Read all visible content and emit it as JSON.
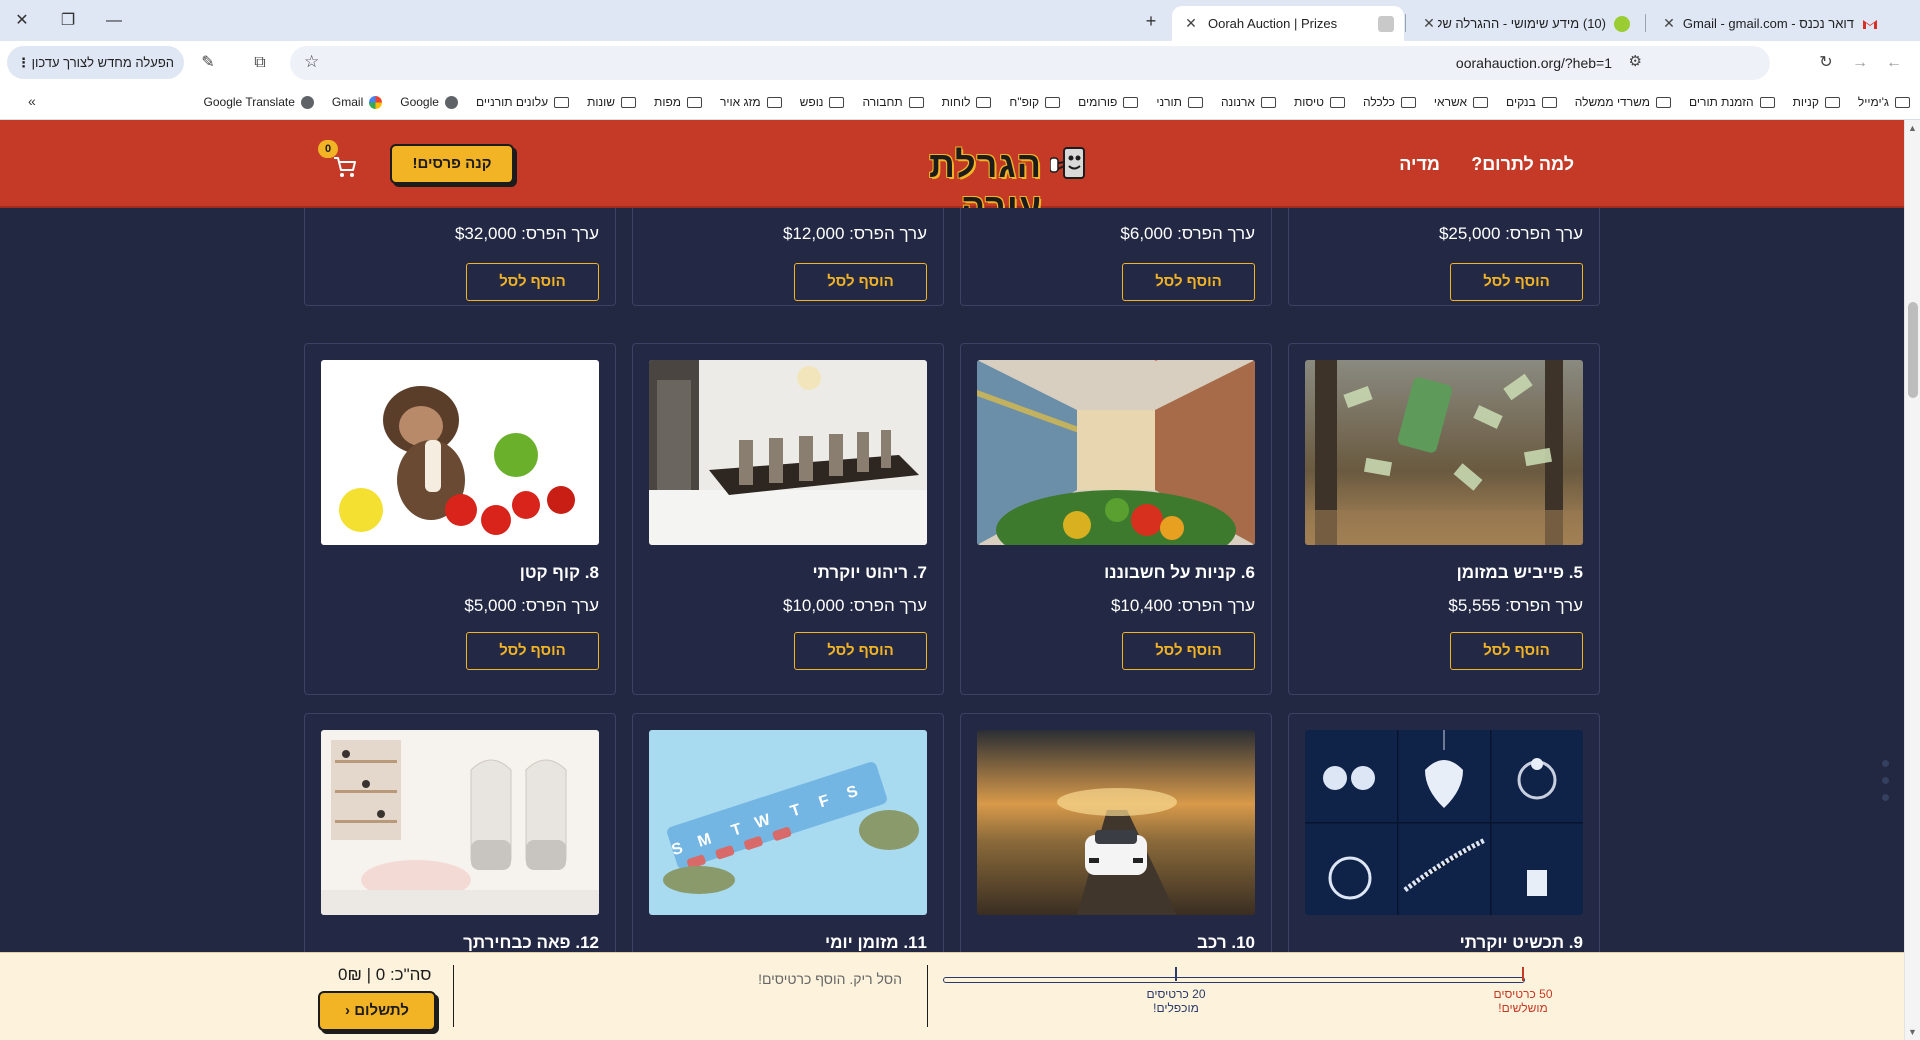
{
  "browser": {
    "tabs": [
      {
        "title": "Oorah Auction | Prizes",
        "active": true
      },
      {
        "title": "(10) מידע שימושי - ההגרלה של",
        "active": false
      },
      {
        "title": "דואר נכנס - Gmail - gmail.com",
        "active": false
      }
    ],
    "url": "oorahauction.org/?heb=1",
    "relaunch_label": "הפעלה מחדש לצורך עדכון",
    "bookmarks": [
      "ג'ימייל",
      "קניות",
      "הזמנת תורים",
      "משרדי ממשלה",
      "בנקים",
      "אשראי",
      "כלכלה",
      "טיסות",
      "ארנונה",
      "תורני",
      "פורומים",
      "קופ\"ח",
      "לוחות",
      "תחבורה",
      "נופש",
      "מזג אויר",
      "מפות",
      "שונות",
      "עלונים תורניים",
      "Google",
      "Gmail",
      "Google Translate"
    ]
  },
  "header": {
    "nav_donate": "למה לתרום?",
    "nav_media": "מדיה",
    "logo_text": "הגרלת עורה",
    "buy_button": "קנה פרסים!",
    "cart_count": "0"
  },
  "prizes_top_row": [
    {
      "value": "ערך הפרס: $25,000",
      "add": "הוסף לסל"
    },
    {
      "value": "ערך הפרס: $6,000",
      "add": "הוסף לסל"
    },
    {
      "value": "ערך הפרס: $12,000",
      "add": "הוסף לסל"
    },
    {
      "value": "ערך הפרס: $32,000",
      "add": "הוסף לסל"
    }
  ],
  "prizes": [
    {
      "name": "5. פייביש במזומן",
      "value": "ערך הפרס: $5,555",
      "add": "הוסף לסל"
    },
    {
      "name": "6. קניות על חשבוננו",
      "value": "ערך הפרס: $10,400",
      "add": "הוסף לסל"
    },
    {
      "name": "7. ריהוט יוקרתי",
      "value": "ערך הפרס: $10,000",
      "add": "הוסף לסל"
    },
    {
      "name": "8. קוף קטן",
      "value": "ערך הפרס: $5,000",
      "add": "הוסף לסל"
    },
    {
      "name": "9. תכשיט יוקרתי"
    },
    {
      "name": "10. רכב"
    },
    {
      "name": "11. מזומן יומי"
    },
    {
      "name": "12. פאה כבחירתך"
    }
  ],
  "checkout": {
    "milestone_50_line1": "50 כרטיסים",
    "milestone_50_line2": "מושלשים!",
    "milestone_20_line1": "20 כרטיסים",
    "milestone_20_line2": "מוכפלים!",
    "empty_message": "הסל ריק. הוסף כרטיסים!",
    "total_text": "סה\"כ: 0 | 0₪",
    "pay_button": "לתשלום",
    "tickets_progress": 0
  },
  "colors": {
    "header_red": "#c43a26",
    "page_navy": "#222742",
    "accent_yellow": "#f2b325",
    "bottom_cream": "#fdf3dc"
  }
}
